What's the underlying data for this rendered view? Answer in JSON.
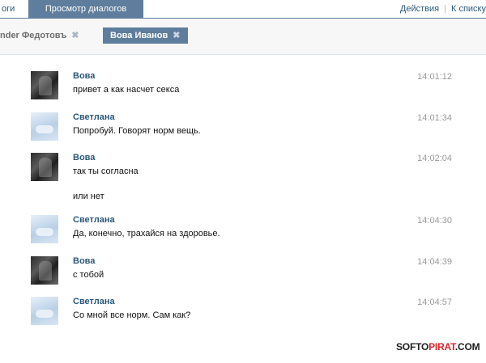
{
  "topbar": {
    "left_tab": "оги",
    "active_tab": "Просмотр диалогов",
    "actions_label": "Действия",
    "back_label": "К списку",
    "separator": "|"
  },
  "peers": [
    {
      "name": "nder Федотовъ",
      "close": "✖"
    },
    {
      "name": "Вова Иванов",
      "close": "✖"
    }
  ],
  "messages": [
    {
      "author": "Вова",
      "text": "привет а как насчет секса",
      "time": "14:01:12"
    },
    {
      "author": "Светлана",
      "text": "Попробуй. Говорят норм вещь.",
      "time": "14:01:34"
    },
    {
      "author": "Вова",
      "text": "так ты согласна",
      "time": "14:02:04"
    },
    {
      "author": "Светлана",
      "text": "Да, конечно, трахайся на здоровье.",
      "time": "14:04:30"
    },
    {
      "author": "Вова",
      "text": "с тобой",
      "time": "14:04:39"
    },
    {
      "author": "Светлана",
      "text": "Со мной все норм. Сам как?",
      "time": "14:04:57"
    }
  ],
  "followup_text": "или нет",
  "watermark": {
    "part1": "SOFTO",
    "part2": "PIRAT",
    "part3": ".COM"
  },
  "colors": {
    "accent": "#5f7d9c",
    "author": "#2b587a",
    "time": "#999999"
  }
}
